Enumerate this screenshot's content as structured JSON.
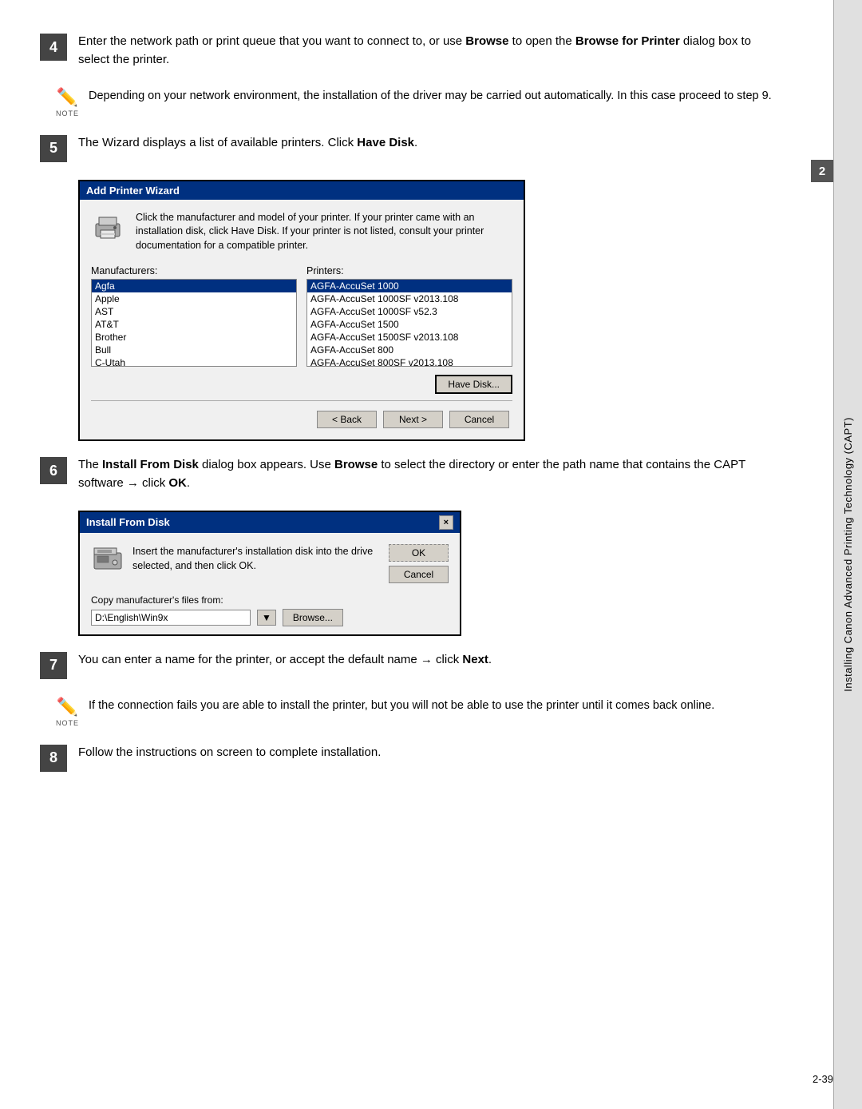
{
  "page": {
    "side_tab_label": "Installing Canon Advanced Printing Technology (CAPT)",
    "page_number": "2-39",
    "chapter_number": "2"
  },
  "steps": {
    "step4": {
      "number": "4",
      "text": "Enter the network path or print queue that you want to connect to, or use ",
      "bold1": "Browse",
      "text2": " to open the ",
      "bold2": "Browse for Printer",
      "text3": " dialog box to select the printer."
    },
    "note1": {
      "label": "NOTE",
      "text": "Depending on your network environment, the installation of the driver may be carried out automatically. In this case proceed to step 9."
    },
    "step5": {
      "number": "5",
      "text": "The Wizard displays a list of available printers. Click ",
      "bold": "Have Disk",
      "text2": "."
    },
    "step6": {
      "number": "6",
      "text": "The ",
      "bold1": "Install From Disk",
      "text2": " dialog box appears. Use ",
      "bold2": "Browse",
      "text3": " to select the directory or enter the path name that contains the CAPT software → click ",
      "bold3": "OK",
      "text4": "."
    },
    "step7": {
      "number": "7",
      "text": "You can enter a name for the printer, or accept the default name → click ",
      "bold": "Next",
      "text2": "."
    },
    "note2": {
      "label": "NOTE",
      "text": "If the connection fails you are able to install the printer, but you will not be able to use the printer until it comes back online."
    },
    "step8": {
      "number": "8",
      "text": "Follow the instructions on screen to complete installation."
    }
  },
  "wizard_dialog": {
    "title": "Add Printer Wizard",
    "header_text": "Click the manufacturer and model of your printer. If your printer came with an installation disk, click Have Disk. If your printer is not listed, consult your printer documentation for a compatible printer.",
    "manufacturers_label": "Manufacturers:",
    "printers_label": "Printers:",
    "manufacturers": [
      {
        "name": "Agfa",
        "selected": true
      },
      {
        "name": "Apple",
        "selected": false
      },
      {
        "name": "AST",
        "selected": false
      },
      {
        "name": "AT&T",
        "selected": false
      },
      {
        "name": "Brother",
        "selected": false
      },
      {
        "name": "Bull",
        "selected": false
      },
      {
        "name": "C-Utah",
        "selected": false
      }
    ],
    "printers": [
      {
        "name": "AGFA-AccuSet 1000",
        "selected": true
      },
      {
        "name": "AGFA-AccuSet 1000SF v2013.108",
        "selected": false
      },
      {
        "name": "AGFA-AccuSet 1000SF v52.3",
        "selected": false
      },
      {
        "name": "AGFA-AccuSet 1500",
        "selected": false
      },
      {
        "name": "AGFA-AccuSet 1500SF v2013.108",
        "selected": false
      },
      {
        "name": "AGFA-AccuSet 800",
        "selected": false
      },
      {
        "name": "AGFA-AccuSet 800SF v2013.108",
        "selected": false
      }
    ],
    "have_disk_button": "Have Disk...",
    "back_button": "< Back",
    "next_button": "Next >",
    "cancel_button": "Cancel"
  },
  "disk_dialog": {
    "title": "Install From Disk",
    "close_button": "×",
    "instructions": "Insert the manufacturer's installation disk into the drive selected, and then click OK.",
    "ok_button": "OK",
    "cancel_button": "Cancel",
    "copy_label": "Copy manufacturer's files from:",
    "path_value": "D:\\English\\Win9x",
    "browse_button": "Browse..."
  }
}
